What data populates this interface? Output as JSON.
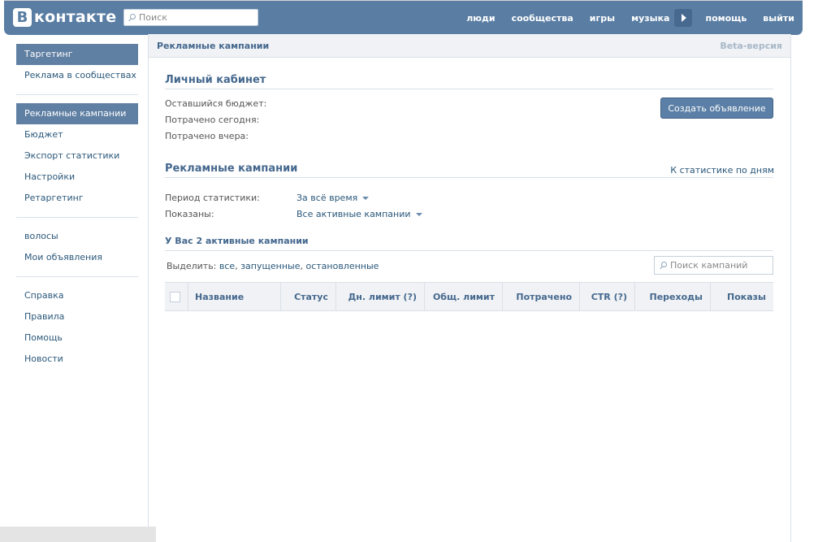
{
  "header": {
    "logo_letter": "В",
    "logo_text": "контакте",
    "search_placeholder": "Поиск",
    "nav": [
      "люди",
      "сообщества",
      "игры",
      "музыка",
      "помощь",
      "выйти"
    ]
  },
  "sidebar": {
    "group1": [
      "Таргетинг",
      "Реклама в сообществах"
    ],
    "group2": [
      "Рекламные кампании",
      "Бюджет",
      "Экспорт статистики",
      "Настройки",
      "Ретаргетинг"
    ],
    "group3": [
      "волосы",
      "Мои объявления"
    ],
    "group4": [
      "Справка",
      "Правила",
      "Помощь",
      "Новости"
    ]
  },
  "panel": {
    "title": "Рекламные кампании",
    "beta": "Beta-версия"
  },
  "cabinet": {
    "title": "Личный кабинет",
    "budget_left": "Оставшийся бюджет:",
    "spent_today": "Потрачено сегодня:",
    "spent_yesterday": "Потрачено вчера:",
    "create_button": "Создать объявление"
  },
  "campaigns": {
    "title": "Рекламные кампании",
    "stats_link": "К статистике по дням",
    "period_label": "Период статистики:",
    "period_value": "За всё время",
    "shown_label": "Показаны:",
    "shown_value": "Все активные кампании",
    "active_count": "У Вас 2 активные кампании",
    "select_prefix": "Выделить:",
    "select_all": "все",
    "select_running": "запущенные",
    "select_stopped": "остановленные",
    "search_placeholder": "Поиск кампаний",
    "columns": [
      "Название",
      "Статус",
      "Дн. лимит (?)",
      "Общ. лимит",
      "Потрачено",
      "CTR (?)",
      "Переходы",
      "Показы"
    ]
  },
  "colors": {
    "header_bg": "#597da3",
    "link": "#2b587a",
    "section_title": "#45688e",
    "active_item": "#5f7fa3"
  }
}
